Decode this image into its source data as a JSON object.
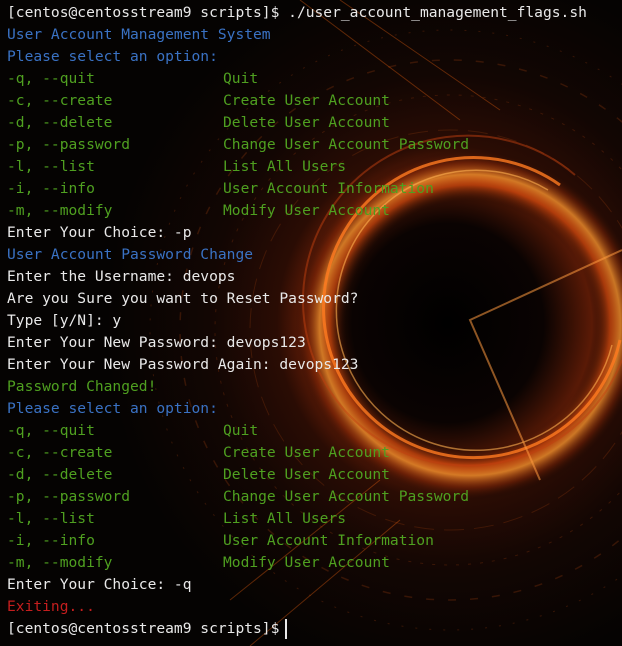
{
  "prompt1": "[centos@centosstream9 scripts]$ ./user_account_management_flags.sh",
  "title": "User Account Management System",
  "select_prompt": "Please select an option:",
  "menu1": [
    {
      "flag": "-q, --quit",
      "desc": "Quit"
    },
    {
      "flag": "-c, --create",
      "desc": "Create User Account"
    },
    {
      "flag": "-d, --delete",
      "desc": "Delete User Account"
    },
    {
      "flag": "-p, --password",
      "desc": "Change User Account Password"
    },
    {
      "flag": "-l, --list",
      "desc": "List All Users"
    },
    {
      "flag": "-i, --info",
      "desc": "User Account Information"
    },
    {
      "flag": "-m, --modify",
      "desc": "Modify User Account"
    }
  ],
  "choice1": "Enter Your Choice: -p",
  "pw_change_title": "User Account Password Change",
  "username_line": "Enter the Username: devops",
  "confirm_line": "Are you Sure you want to Reset Password?",
  "yn_line": "Type [y/N]: y",
  "newpw_line": "Enter Your New Password: devops123",
  "newpw_again_line": "Enter Your New Password Again: devops123",
  "pw_changed": "Password Changed!",
  "select_prompt2": "Please select an option:",
  "menu2": [
    {
      "flag": "-q, --quit",
      "desc": "Quit"
    },
    {
      "flag": "-c, --create",
      "desc": "Create User Account"
    },
    {
      "flag": "-d, --delete",
      "desc": "Delete User Account"
    },
    {
      "flag": "-p, --password",
      "desc": "Change User Account Password"
    },
    {
      "flag": "-l, --list",
      "desc": "List All Users"
    },
    {
      "flag": "-i, --info",
      "desc": "User Account Information"
    },
    {
      "flag": "-m, --modify",
      "desc": "Modify User Account"
    }
  ],
  "choice2": "Enter Your Choice: -q",
  "exiting": "Exiting...",
  "prompt2": "[centos@centosstream9 scripts]$",
  "colors": {
    "text": "#e9e9e9",
    "info_blue": "#3a72c4",
    "option_green": "#4fa020",
    "error_red": "#c41e1e",
    "background": "#050302",
    "glow_orange": "#ff6a10"
  }
}
